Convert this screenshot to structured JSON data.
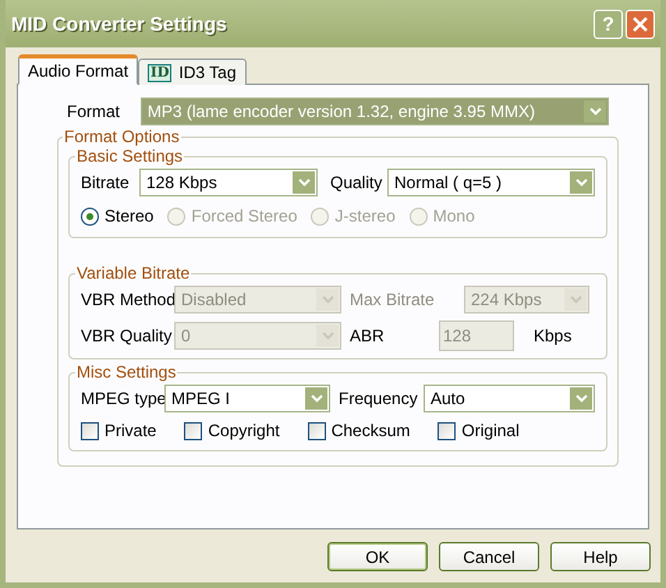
{
  "window": {
    "title": "MID Converter Settings"
  },
  "title_buttons": [
    {
      "kind": "help",
      "label": "?"
    },
    {
      "kind": "close"
    }
  ],
  "tabs": [
    {
      "label": "Audio Format",
      "selected": true
    },
    {
      "label": "ID3 Tag",
      "selected": false,
      "icon_text": "ID"
    }
  ],
  "format": {
    "label": "Format",
    "value": "MP3 (lame encoder version 1.32, engine 3.95 MMX)",
    "highlighted": true
  },
  "format_options": {
    "title": "Format Options",
    "basic": {
      "title": "Basic Settings",
      "bitrate": {
        "label": "Bitrate",
        "value": "128 Kbps"
      },
      "quality": {
        "label": "Quality",
        "value": "Normal ( q=5 )"
      },
      "channels": [
        {
          "label": "Stereo",
          "selected": true,
          "disabled": false
        },
        {
          "label": "Forced Stereo",
          "selected": false,
          "disabled": true
        },
        {
          "label": "J-stereo",
          "selected": false,
          "disabled": true
        },
        {
          "label": "Mono",
          "selected": false,
          "disabled": true
        }
      ]
    },
    "vbr": {
      "title": "Variable Bitrate",
      "method": {
        "label": "VBR Method",
        "value": "Disabled",
        "disabled": true
      },
      "max": {
        "label": "Max Bitrate",
        "value": "224 Kbps",
        "disabled": true
      },
      "quality": {
        "label": "VBR Quality",
        "value": "0",
        "disabled": true
      },
      "abr": {
        "label": "ABR",
        "value": "128",
        "unit": "Kbps",
        "disabled": true
      }
    },
    "misc": {
      "title": "Misc Settings",
      "mpeg": {
        "label": "MPEG type",
        "value": "MPEG I"
      },
      "frequency": {
        "label": "Frequency",
        "value": "Auto"
      },
      "flags": [
        {
          "label": "Private",
          "checked": false
        },
        {
          "label": "Copyright",
          "checked": false
        },
        {
          "label": "Checksum",
          "checked": false
        },
        {
          "label": "Original",
          "checked": false
        }
      ]
    }
  },
  "buttons": [
    {
      "label": "OK",
      "default": true
    },
    {
      "label": "Cancel",
      "default": false
    },
    {
      "label": "Help",
      "default": false
    }
  ]
}
